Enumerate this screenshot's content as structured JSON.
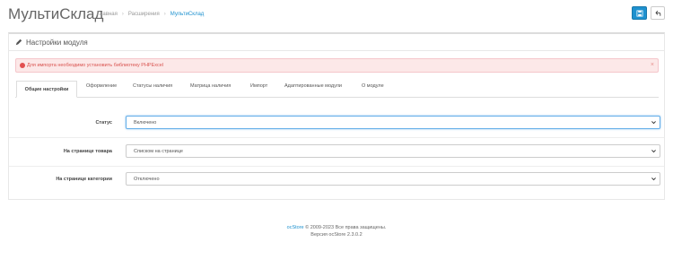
{
  "header": {
    "title": "МультиСклад",
    "breadcrumb": [
      "Главная",
      "Расширения",
      "МультиСклад"
    ]
  },
  "panel": {
    "title": "Настройки модуля"
  },
  "alert": {
    "text": "Для импорта необходимо установить библиотеку PHPExcel",
    "close": "×"
  },
  "tabs": [
    "Общие настройки",
    "Оформление",
    "Статусы наличия",
    "Матрица наличия",
    "Импорт",
    "Адаптированные модули",
    "О модуле"
  ],
  "form": {
    "status_label": "Статус",
    "status_value": "Включено",
    "product_page_label": "На странице товара",
    "product_page_value": "Списком на странице",
    "category_page_label": "На странице категории",
    "category_page_value": "Отключено"
  },
  "footer": {
    "brand": "ocStore",
    "copyright": "© 2009-2023 Все права защищены.",
    "version": "Версия ocStore 2.3.0.2"
  },
  "colors": {
    "accent": "#1e91cf",
    "alert_bg": "#fce8e8",
    "alert_text": "#d9534f"
  }
}
